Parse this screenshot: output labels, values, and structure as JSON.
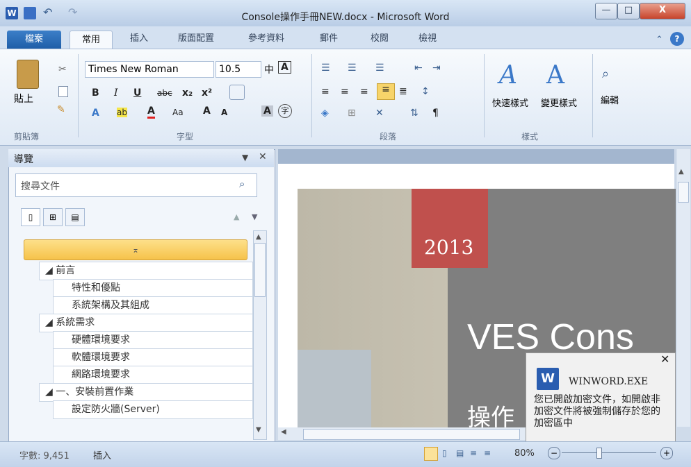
{
  "window": {
    "title": "Console操作手冊NEW.docx - Microsoft Word",
    "minimize": "—",
    "maximize": "□",
    "close": "X"
  },
  "tabs": [
    "檔案",
    "常用",
    "插入",
    "版面配置",
    "參考資料",
    "郵件",
    "校閱",
    "檢視"
  ],
  "ribbon": {
    "clipboard": {
      "paste": "貼上",
      "label": "剪貼簿"
    },
    "font": {
      "name": "Times New Roman",
      "size": "10.5",
      "label": "字型"
    },
    "paragraph": {
      "label": "段落"
    },
    "styles": {
      "quick": "快速樣式",
      "change": "變更樣式",
      "label": "樣式"
    },
    "editing": {
      "edit": "編輯"
    }
  },
  "nav": {
    "title": "導覽",
    "search_placeholder": "搜尋文件",
    "items": [
      {
        "label": "前言",
        "level": 1
      },
      {
        "label": "特性和優點",
        "level": 2
      },
      {
        "label": "系統架構及其組成",
        "level": 2
      },
      {
        "label": "系統需求",
        "level": 1
      },
      {
        "label": "硬體環境要求",
        "level": 2
      },
      {
        "label": "軟體環境要求",
        "level": 2
      },
      {
        "label": "網路環境要求",
        "level": 2
      },
      {
        "label": "一、安裝前置作業",
        "level": 1
      },
      {
        "label": "設定防火牆(Server)",
        "level": 2
      }
    ]
  },
  "document": {
    "year": "2013",
    "cover_title": "VES Cons",
    "cover_subtitle": "操作"
  },
  "notification": {
    "app": "WINWORD.EXE",
    "message": "您已開啟加密文件，如開啟非加密文件將被強制儲存於您的加密區中"
  },
  "status": {
    "word_count": "字數: 9,451",
    "mode": "插入",
    "zoom": "80%",
    "zoom_level_percent": 80
  },
  "colors": {
    "accent": "#c0504d",
    "cover_gray": "#7f7f7f",
    "file_tab": "#2a6bb8"
  }
}
